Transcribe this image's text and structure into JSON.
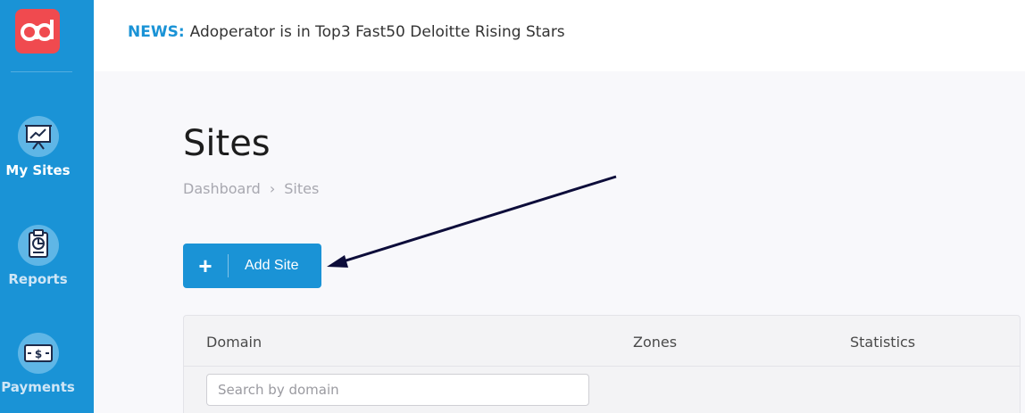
{
  "sidebar": {
    "logo_text": "ad",
    "items": [
      {
        "label": "My Sites",
        "icon": "presentation-board-icon",
        "active": true
      },
      {
        "label": "Reports",
        "icon": "report-clipboard-icon",
        "active": false
      },
      {
        "label": "Payments",
        "icon": "money-bill-icon",
        "active": false
      }
    ]
  },
  "topbar": {
    "news_label": "NEWS:",
    "news_text": "Adoperator is in Top3 Fast50 Deloitte Rising Stars"
  },
  "page": {
    "title": "Sites",
    "breadcrumb": [
      "Dashboard",
      "Sites"
    ],
    "breadcrumb_separator": "›"
  },
  "actions": {
    "add_plus": "+",
    "add_label": "Add Site"
  },
  "table": {
    "columns": [
      "Domain",
      "Zones",
      "Statistics"
    ],
    "search_placeholder": "Search by domain"
  },
  "colors": {
    "sidebar": "#1a93d6",
    "accent": "#1a93d6",
    "logo": "#f04a4f",
    "annotation_arrow": "#0d0d3a"
  }
}
